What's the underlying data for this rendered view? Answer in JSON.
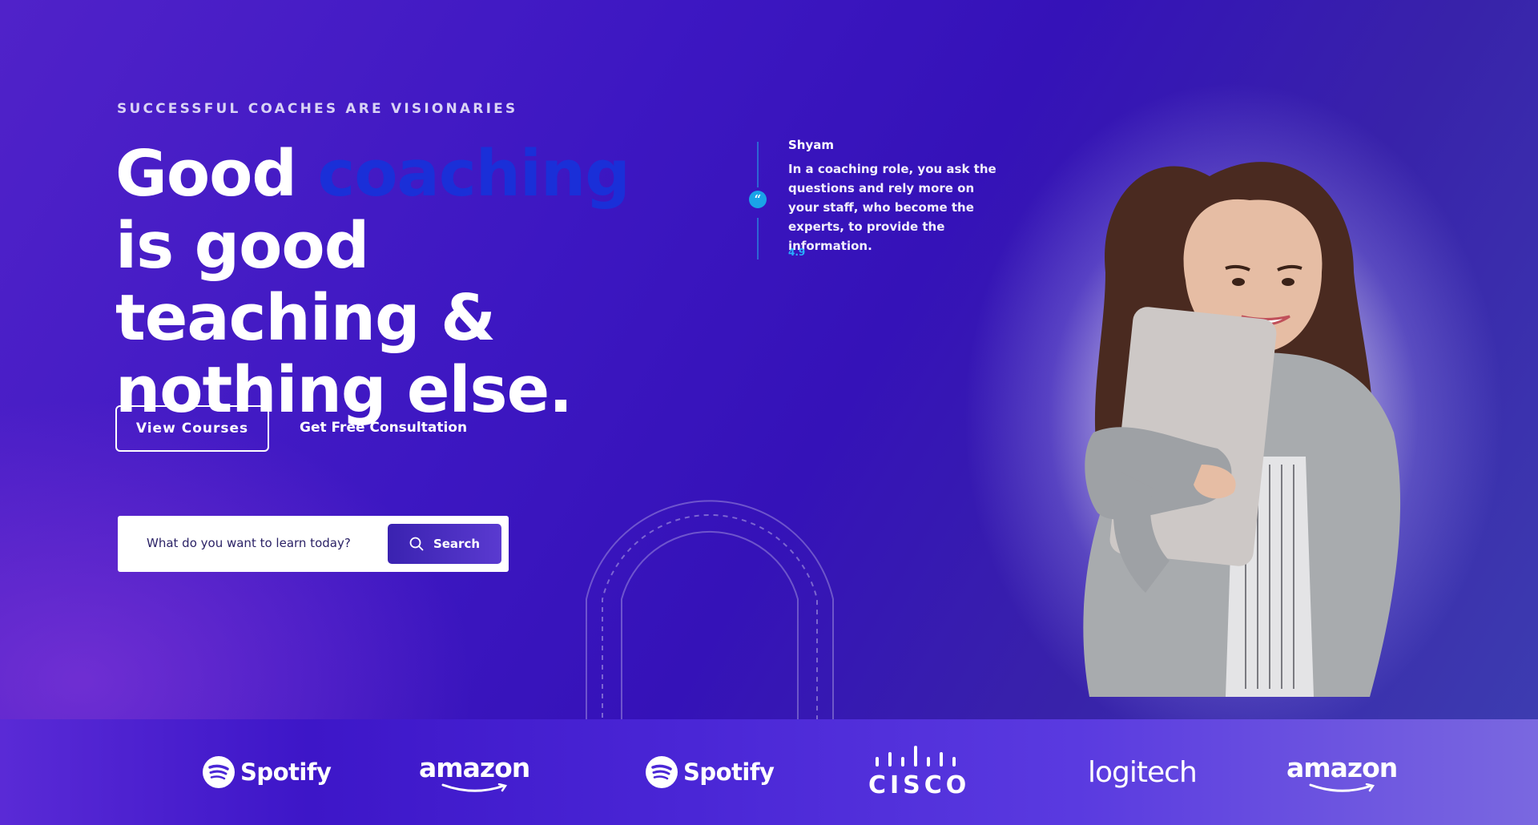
{
  "hero": {
    "eyebrow": "SUCCESSFUL COACHES ARE VISIONARIES",
    "headline_part1": "Good ",
    "headline_accent": "coaching",
    "headline_part2": " is good teaching & nothing else.",
    "primary_button": "View Courses",
    "secondary_link": "Get Free Consultation",
    "search": {
      "placeholder": "What do you want to learn today?",
      "button_label": "Search"
    }
  },
  "testimonial": {
    "quote_mark": "“",
    "name": "Shyam",
    "text": "In a coaching role, you ask the questions and rely more on your staff, who become the experts, to provide the information.",
    "rating": "4.9"
  },
  "logos": [
    {
      "name": "Spotify",
      "icon": "spotify-icon"
    },
    {
      "name": "amazon",
      "icon": "amazon-smile-icon"
    },
    {
      "name": "Spotify",
      "icon": "spotify-icon"
    },
    {
      "name": "CISCO",
      "icon": "cisco-bars-icon"
    },
    {
      "name": "logitech",
      "icon": ""
    },
    {
      "name": "amazon",
      "icon": "amazon-smile-icon"
    }
  ],
  "colors": {
    "background": "#3a1cc0",
    "accent_word": "#1a2fd8",
    "rating": "#28b0ff",
    "quote_badge": "#1aa3e8"
  }
}
